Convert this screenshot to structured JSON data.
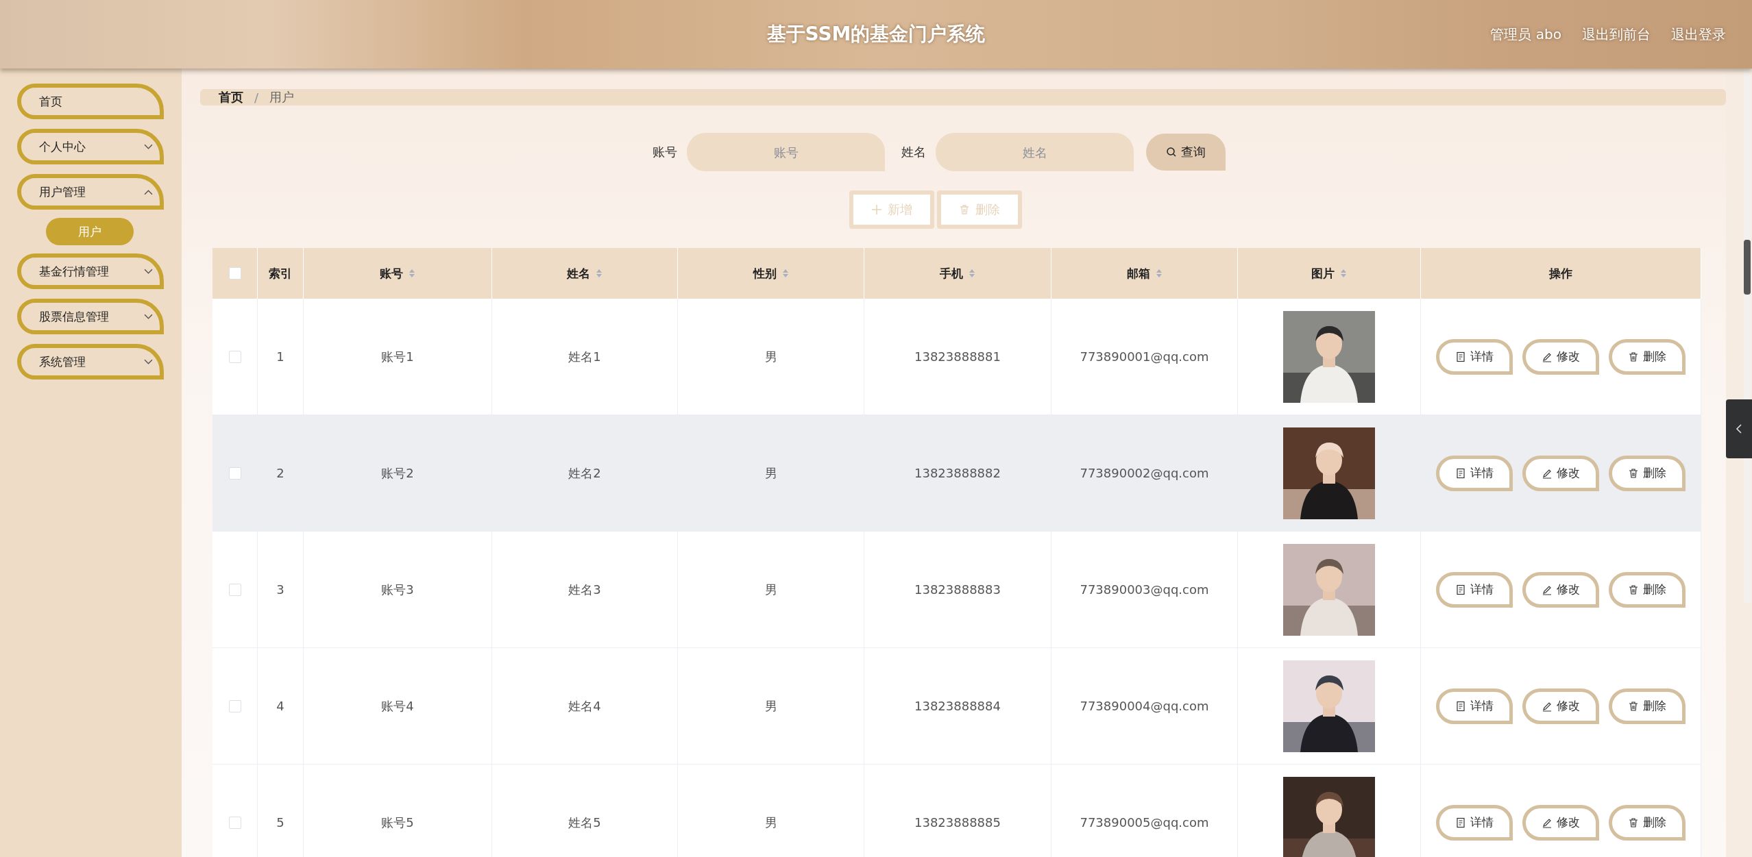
{
  "header": {
    "title": "基于SSM的基金门户系统",
    "links": [
      "管理员 abo",
      "退出到前台",
      "退出登录"
    ]
  },
  "sidebar": {
    "items": [
      {
        "label": "首页",
        "kind": "link"
      },
      {
        "label": "个人中心",
        "kind": "submenu",
        "expanded": false
      },
      {
        "label": "用户管理",
        "kind": "submenu",
        "expanded": true,
        "children": [
          {
            "label": "用户",
            "selected": true
          }
        ]
      },
      {
        "label": "基金行情管理",
        "kind": "submenu",
        "expanded": false
      },
      {
        "label": "股票信息管理",
        "kind": "submenu",
        "expanded": false
      },
      {
        "label": "系统管理",
        "kind": "submenu",
        "expanded": false
      }
    ]
  },
  "breadcrumb": [
    "首页",
    "用户"
  ],
  "breadcrumb_separator": "/",
  "search": {
    "fields": [
      {
        "label": "账号",
        "placeholder": "账号"
      },
      {
        "label": "姓名",
        "placeholder": "姓名"
      }
    ],
    "button": "查询"
  },
  "toolbar": {
    "buttons": [
      {
        "label": "新增",
        "kind": "add",
        "disabled": true
      },
      {
        "label": "删除",
        "kind": "delete",
        "disabled": true
      }
    ]
  },
  "table": {
    "columns": [
      {
        "label": "索引",
        "sortable": false
      },
      {
        "label": "账号",
        "sortable": true
      },
      {
        "label": "姓名",
        "sortable": true
      },
      {
        "label": "性别",
        "sortable": true
      },
      {
        "label": "手机",
        "sortable": true
      },
      {
        "label": "邮箱",
        "sortable": true
      },
      {
        "label": "图片",
        "sortable": true
      },
      {
        "label": "操作",
        "sortable": false
      }
    ],
    "all_checked": false,
    "rows": [
      {
        "index": "1",
        "account": "账号1",
        "name": "姓名1",
        "gender": "男",
        "phone": "13823888881",
        "email": "773890001@qq.com",
        "hovered": false,
        "checked": false,
        "actions": [
          "详情",
          "修改",
          "删除"
        ]
      },
      {
        "index": "2",
        "account": "账号2",
        "name": "姓名2",
        "gender": "男",
        "phone": "13823888882",
        "email": "773890002@qq.com",
        "hovered": true,
        "checked": false,
        "actions": [
          "详情",
          "修改",
          "删除"
        ]
      },
      {
        "index": "3",
        "account": "账号3",
        "name": "姓名3",
        "gender": "男",
        "phone": "13823888883",
        "email": "773890003@qq.com",
        "hovered": false,
        "checked": false,
        "actions": [
          "详情",
          "修改",
          "删除"
        ]
      },
      {
        "index": "4",
        "account": "账号4",
        "name": "姓名4",
        "gender": "男",
        "phone": "13823888884",
        "email": "773890004@qq.com",
        "hovered": false,
        "checked": false,
        "actions": [
          "详情",
          "修改",
          "删除"
        ]
      },
      {
        "index": "5",
        "account": "账号5",
        "name": "姓名5",
        "gender": "男",
        "phone": "13823888885",
        "email": "773890005@qq.com",
        "hovered": false,
        "checked": false,
        "actions": [
          "详情",
          "修改",
          "删除"
        ]
      }
    ]
  }
}
